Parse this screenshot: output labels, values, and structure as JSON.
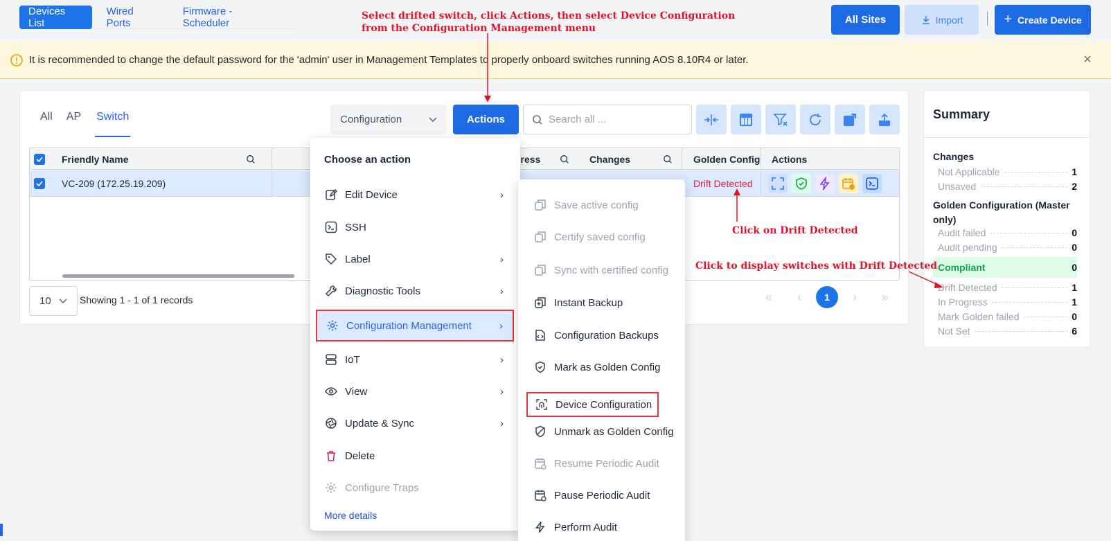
{
  "top_tabs": [
    "Devices List",
    "Wired Ports",
    "Firmware - Scheduler"
  ],
  "header_buttons": {
    "all_sites": "All Sites",
    "import": "Import",
    "create_device": "Create Device"
  },
  "banner": {
    "text": "It is recommended to change the default password for the 'admin' user in Management Templates to properly onboard switches running AOS 8.10R4 or later."
  },
  "device_tabs": [
    "All",
    "AP",
    "Switch"
  ],
  "toolbar": {
    "config_select": "Configuration",
    "actions_label": "Actions",
    "search_placeholder": "Search all ..."
  },
  "table": {
    "headers": {
      "friendly_name": "Friendly Name",
      "address": "dress",
      "changes": "Changes",
      "golden_config": "Golden Config",
      "actions": "Actions"
    },
    "rows": [
      {
        "friendly_name": "VC-209 (172.25.19.209)",
        "golden_config": "Drift Detected"
      }
    ]
  },
  "pagination": {
    "per_page": "10",
    "showing": "Showing 1 - 1 of 1 records",
    "current_page": "1"
  },
  "summary": {
    "title": "Summary",
    "changes_heading": "Changes",
    "changes": [
      {
        "label": "Not Applicable",
        "value": "1"
      },
      {
        "label": "Unsaved",
        "value": "2"
      }
    ],
    "golden_heading": "Golden Configuration (Master only)",
    "golden": [
      {
        "label": "Audit failed",
        "value": "0"
      },
      {
        "label": "Audit pending",
        "value": "0"
      },
      {
        "label": "Compliant",
        "value": "0"
      },
      {
        "label": "Drift Detected",
        "value": "1"
      },
      {
        "label": "In Progress",
        "value": "1"
      },
      {
        "label": "Mark Golden failed",
        "value": "0"
      },
      {
        "label": "Not Set",
        "value": "6"
      }
    ]
  },
  "menu": {
    "title": "Choose an action",
    "items": [
      "Edit Device",
      "SSH",
      "Label",
      "Diagnostic Tools",
      "Configuration Management",
      "IoT",
      "View",
      "Update & Sync",
      "Delete",
      "Configure Traps"
    ],
    "more": "More details"
  },
  "submenu": {
    "items": [
      "Save active config",
      "Certify saved config",
      "Sync with certified config",
      "Instant Backup",
      "Configuration Backups",
      "Mark as Golden Config",
      "Device Configuration",
      "Unmark as Golden Config",
      "Resume Periodic Audit",
      "Pause Periodic Audit",
      "Perform Audit"
    ]
  },
  "annotations": {
    "top_line1": "Select drifted switch, click Actions, then select Device Configuration",
    "top_line2": "from the Configuration Management menu",
    "drift": "Click on Drift Detected",
    "summary": "Click to display switches with Drift Detected"
  },
  "colors": {
    "primary": "#1d6ae5",
    "annotation_red": "#e3122b",
    "drift_text": "#e11d48",
    "compliant_green": "#16a34a"
  }
}
